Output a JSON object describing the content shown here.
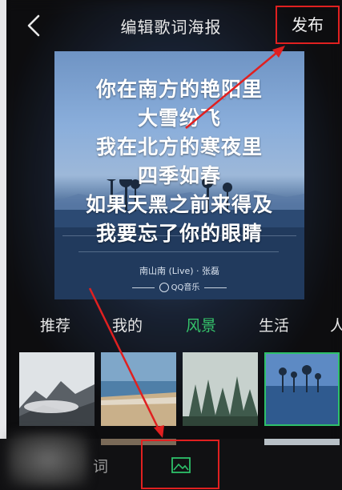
{
  "header": {
    "title": "编辑歌词海报",
    "publish_label": "发布"
  },
  "poster": {
    "lyrics": [
      "你在南方的艳阳里",
      "大雪纷飞",
      "我在北方的寒夜里",
      "四季如春",
      "如果天黑之前来得及",
      "我要忘了你的眼睛"
    ],
    "song_info": "南山南 (Live) · 张磊",
    "brand": "QQ音乐"
  },
  "tabs": [
    {
      "label": "推荐"
    },
    {
      "label": "我的"
    },
    {
      "label": "风景"
    },
    {
      "label": "生活"
    },
    {
      "label": "人"
    }
  ],
  "active_tab": "风景",
  "thumbnails": [
    {
      "name": "misty-mountains"
    },
    {
      "name": "beach-sunset"
    },
    {
      "name": "foggy-forest"
    },
    {
      "name": "lake-trees",
      "selected": true
    }
  ],
  "bottom_bar": {
    "partial_text": "词"
  },
  "colors": {
    "accent_green": "#35c46b",
    "annotation_red": "#e02020",
    "background": "#0d0d0f"
  }
}
